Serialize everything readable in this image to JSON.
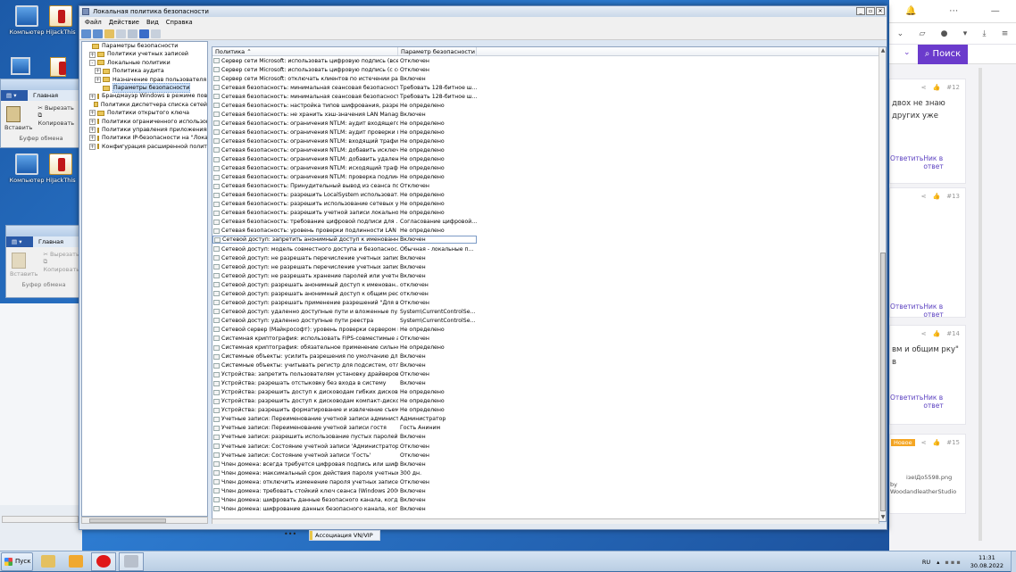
{
  "desktop": {
    "icons": [
      {
        "label": "Компьютер"
      },
      {
        "label": "HiJackThis"
      },
      {
        "label": "Компьютер"
      },
      {
        "label": "HiJackThis"
      }
    ]
  },
  "explorer_fragment": {
    "tab_home": "Главная",
    "cut": "Вырезать",
    "copy": "Копировать",
    "paste": "Вставить",
    "clipboard_group": "Буфер обмена"
  },
  "browser": {
    "search_button": "Поиск",
    "cards": [
      {
        "num": "#12",
        "text": "двох не знаю других уже",
        "reply": "Ответить",
        "footer": "Ник в ответ"
      },
      {
        "num": "#13",
        "text": "",
        "reply": "Ответить",
        "footer": "Ник в ответ"
      },
      {
        "num": "#14",
        "text": "вм и общим рку\" в",
        "reply": "Ответить",
        "footer": "Ник в ответ"
      },
      {
        "num": "#15",
        "badge": "Новое",
        "text": "",
        "img_alt": "ізеІДо5598.png",
        "credit": "by WoodandleatherStudio"
      }
    ]
  },
  "window": {
    "title": "Локальная политика безопасности",
    "menu": [
      "Файл",
      "Действие",
      "Вид",
      "Справка"
    ],
    "tree": [
      {
        "label": "Параметры безопасности",
        "level": 0,
        "exp": "",
        "folder": true
      },
      {
        "label": "Политики учетных записей",
        "level": 1,
        "exp": "+"
      },
      {
        "label": "Локальные политики",
        "level": 1,
        "exp": "-"
      },
      {
        "label": "Политика аудита",
        "level": 2,
        "exp": "+"
      },
      {
        "label": "Назначение прав пользователя",
        "level": 2,
        "exp": "+"
      },
      {
        "label": "Параметры безопасности",
        "level": 2,
        "exp": "",
        "sel": true
      },
      {
        "label": "Брандмауэр Windows в режиме повыш",
        "level": 1,
        "exp": "+"
      },
      {
        "label": "Политики диспетчера списка сетей",
        "level": 1,
        "exp": ""
      },
      {
        "label": "Политики открытого ключа",
        "level": 1,
        "exp": "+"
      },
      {
        "label": "Политики ограниченного использова",
        "level": 1,
        "exp": "+"
      },
      {
        "label": "Политики управления приложениями",
        "level": 1,
        "exp": "+"
      },
      {
        "label": "Политики IP-безопасности на \"Локальн",
        "level": 1,
        "exp": "+"
      },
      {
        "label": "Конфигурация расширенной политики",
        "level": 1,
        "exp": "+"
      }
    ],
    "list_headers": {
      "policy": "Политика",
      "setting": "Параметр безопасности"
    },
    "rows": [
      [
        "Сервер сети Microsoft: использовать цифровую подпись (все...",
        "Отключен"
      ],
      [
        "Сервер сети Microsoft: использовать цифровую подпись (с со...",
        "Отключен"
      ],
      [
        "Сервер сети Microsoft: отключать клиентов по истечении ра...",
        "Включен"
      ],
      [
        "Сетевая безопасность: минимальная сеансовая безопасност...",
        "Требовать 128-битное ш..."
      ],
      [
        "Сетевая безопасность: минимальная сеансовая безопасност...",
        "Требовать 128-битное ш..."
      ],
      [
        "Сетевая безопасность: настройка типов шифрования, разре...",
        "Не определено"
      ],
      [
        "Сетевая безопасность: не хранить хэш-значения LAN Manag...",
        "Включен"
      ],
      [
        "Сетевая безопасность: ограничения NTLM: аудит входящего...",
        "Не определено"
      ],
      [
        "Сетевая безопасность: ограничения NTLM: аудит проверки п...",
        "Не определено"
      ],
      [
        "Сетевая безопасность: ограничения NTLM: входящий трафи...",
        "Не определено"
      ],
      [
        "Сетевая безопасность: ограничения NTLM: добавить исключ...",
        "Не определено"
      ],
      [
        "Сетевая безопасность: ограничения NTLM: добавить удален...",
        "Не определено"
      ],
      [
        "Сетевая безопасность: ограничения NTLM: исходящий траф...",
        "Не определено"
      ],
      [
        "Сетевая безопасность: ограничения NTLM: проверка подлин...",
        "Не определено"
      ],
      [
        "Сетевая безопасность: Принудительный вывод из сеанса по...",
        "Отключен"
      ],
      [
        "Сетевая безопасность: разрешить LocalSystem использоват...",
        "Не определено"
      ],
      [
        "Сетевая безопасность: разрешить использование сетевых у...",
        "Не определено"
      ],
      [
        "Сетевая безопасность: разрешить учетной записи локально...",
        "Не определено"
      ],
      [
        "Сетевая безопасность: требование цифровой подписи для ...",
        "Согласование цифровой..."
      ],
      [
        "Сетевая безопасность: уровень проверки подлинности LAN ...",
        "Не определено"
      ],
      [
        "Сетевой доступ: запретить анонимный доступ к именованны...",
        "Включен"
      ],
      [
        "Сетевой доступ: модель совместного доступа и безопаснос...",
        "Обычная - локальные п..."
      ],
      [
        "Сетевой доступ: не разрешать перечисление учетных запис...",
        "Включен"
      ],
      [
        "Сетевой доступ: не разрешать перечисление учетных запис...",
        "Включен"
      ],
      [
        "Сетевой доступ: не разрешать хранение паролей или учетн...",
        "Включен"
      ],
      [
        "Сетевой доступ: разрешать анонимный доступ к именован...",
        "отключен"
      ],
      [
        "Сетевой доступ: разрешать анонимный доступ к общим ресу...",
        "отключен"
      ],
      [
        "Сетевой доступ: разрешать применение разрешений \"Для вс...",
        "Отключен"
      ],
      [
        "Сетевой доступ: удаленно доступные пути и вложенные пу...",
        "System\\CurrentControlSe..."
      ],
      [
        "Сетевой доступ: удаленно доступные пути реестра",
        "System\\CurrentControlSe..."
      ],
      [
        "Сетевой сервер (Майкрософт): уровень проверки сервером и...",
        "Не определено"
      ],
      [
        "Системная криптография: использовать FIPS-совместимые а...",
        "Отключен"
      ],
      [
        "Системная криптография: обязательное применение сильно...",
        "Не определено"
      ],
      [
        "Системные объекты: усилить разрешения по умолчанию для ...",
        "Включен"
      ],
      [
        "Системные объекты: учитывать регистр для подсистем, отл...",
        "Включен"
      ],
      [
        "Устройства: запретить пользователям установку драйверов...",
        "Отключен"
      ],
      [
        "Устройства: разрешать отстыковку без входа в систему",
        "Включен"
      ],
      [
        "Устройства: разрешить доступ к дисководам гибких дисков ...",
        "Не определено"
      ],
      [
        "Устройства: разрешить доступ к дисководам компакт-диско...",
        "Не определено"
      ],
      [
        "Устройства: разрешить форматирование и извлечение съемн...",
        "Не определено"
      ],
      [
        "Учетные записи: Переименование учетной записи администр...",
        "Администратор"
      ],
      [
        "Учетные записи: Переименование учетной записи гостя",
        "Гость Аниним"
      ],
      [
        "Учетные записи: разрешить использование пустых паролей ...",
        "Включен"
      ],
      [
        "Учетные записи: Состояние учетной записи 'Администратор'",
        "Отключен"
      ],
      [
        "Учетные записи: Состояние учетной записи 'Гость'",
        "Отключен"
      ],
      [
        "Член домена: всегда требуется цифровая подпись или шиф...",
        "Включен"
      ],
      [
        "Член домена: максимальный срок действия пароля учетных ...",
        "300 дн."
      ],
      [
        "Член домена: отключить изменение пароля учетных записей...",
        "Отключен"
      ],
      [
        "Член домена: требовать стойкий ключ сеанса (Windows 2000...",
        "Включен"
      ],
      [
        "Член домена: шифровать данные безопасного канала, когда...",
        "Включен"
      ],
      [
        "Член домена: шифрование данных безопасного канала, когд...",
        "Включен"
      ]
    ],
    "selected_row": 20
  },
  "background": {
    "assoc_label": "Ассоциация VN/VIP",
    "dots": "•••"
  },
  "taskbar": {
    "start": "Пуск",
    "lang": "RU",
    "time": "11:31",
    "date": "30.08.2022"
  }
}
